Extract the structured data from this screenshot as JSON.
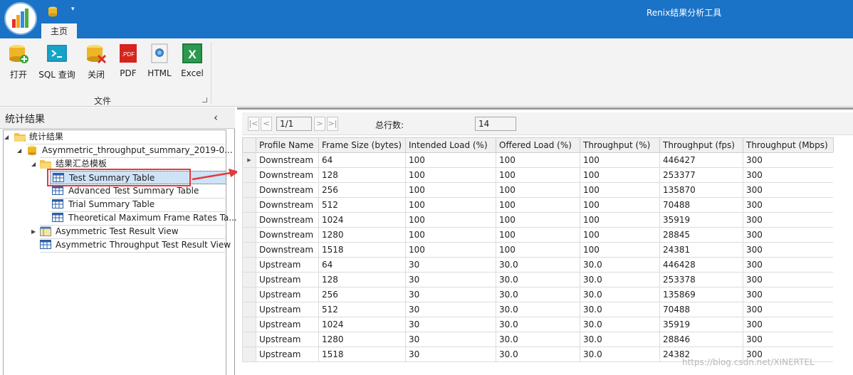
{
  "window": {
    "title": "Renix结果分析工具"
  },
  "ribbon": {
    "tab_home": "主页",
    "buttons": [
      {
        "label": "打开",
        "icon": "open-database-icon"
      },
      {
        "label": "SQL 查询",
        "icon": "sql-console-icon"
      },
      {
        "label": "关闭",
        "icon": "close-database-icon"
      },
      {
        "label": "PDF",
        "icon": "pdf-icon"
      },
      {
        "label": "HTML",
        "icon": "html-icon"
      },
      {
        "label": "Excel",
        "icon": "excel-icon"
      }
    ],
    "group_label": "文件"
  },
  "left_panel": {
    "title": "统计结果",
    "collapse_glyph": "‹",
    "tree": {
      "root": "统计结果",
      "db": "Asymmetric_throughput_summary_2019-0...",
      "folder": "结果汇总模板",
      "tables": [
        "Test Summary Table",
        "Advanced Test Summary Table",
        "Trial Summary Table",
        "Theoretical Maximum Frame Rates Ta..."
      ],
      "views": [
        "Asymmetric Test Result View",
        "Asymmetric Throughput Test Result View"
      ]
    }
  },
  "pager": {
    "first": "|<",
    "prev": "<",
    "page": "1/1",
    "next": ">",
    "last": ">|",
    "row_count_label": "总行数:",
    "row_count": "14"
  },
  "grid": {
    "columns": [
      "Profile Name",
      "Frame Size (bytes)",
      "Intended Load (%)",
      "Offered Load (%)",
      "Throughput (%)",
      "Throughput (fps)",
      "Throughput (Mbps)"
    ],
    "rows": [
      [
        "Downstream",
        "64",
        "100",
        "100",
        "100",
        "446427",
        "300"
      ],
      [
        "Downstream",
        "128",
        "100",
        "100",
        "100",
        "253377",
        "300"
      ],
      [
        "Downstream",
        "256",
        "100",
        "100",
        "100",
        "135870",
        "300"
      ],
      [
        "Downstream",
        "512",
        "100",
        "100",
        "100",
        "70488",
        "300"
      ],
      [
        "Downstream",
        "1024",
        "100",
        "100",
        "100",
        "35919",
        "300"
      ],
      [
        "Downstream",
        "1280",
        "100",
        "100",
        "100",
        "28845",
        "300"
      ],
      [
        "Downstream",
        "1518",
        "100",
        "100",
        "100",
        "24381",
        "300"
      ],
      [
        "Upstream",
        "64",
        "30",
        "30.0",
        "30.0",
        "446428",
        "300"
      ],
      [
        "Upstream",
        "128",
        "30",
        "30.0",
        "30.0",
        "253378",
        "300"
      ],
      [
        "Upstream",
        "256",
        "30",
        "30.0",
        "30.0",
        "135869",
        "300"
      ],
      [
        "Upstream",
        "512",
        "30",
        "30.0",
        "30.0",
        "70488",
        "300"
      ],
      [
        "Upstream",
        "1024",
        "30",
        "30.0",
        "30.0",
        "35919",
        "300"
      ],
      [
        "Upstream",
        "1280",
        "30",
        "30.0",
        "30.0",
        "28846",
        "300"
      ],
      [
        "Upstream",
        "1518",
        "30",
        "30.0",
        "30.0",
        "24382",
        "300"
      ]
    ]
  },
  "watermark": "https://blog.csdn.net/XINERTEL",
  "colors": {
    "titlebar": "#1a73c7",
    "highlight": "#e33b3b",
    "selection": "#cfe3f7"
  }
}
